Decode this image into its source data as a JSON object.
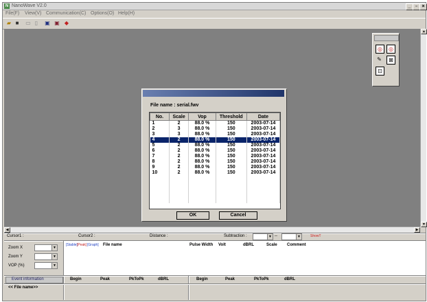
{
  "app": {
    "title": "NanoWave V2.0",
    "window_buttons": [
      "_",
      "▫",
      "×"
    ]
  },
  "menu": [
    "File(F)",
    "View(V)",
    "Communication(C)",
    "Options(O)",
    "Help(H)"
  ],
  "dialog": {
    "file_name": "File name : serial.fwv",
    "columns": [
      "No.",
      "Scale",
      "Vop",
      "Threshold",
      "Date"
    ],
    "rows": [
      [
        "1",
        "2",
        "88.0 %",
        "150",
        "2003-07-14"
      ],
      [
        "2",
        "3",
        "88.0 %",
        "150",
        "2003-07-14"
      ],
      [
        "3",
        "3",
        "88.0 %",
        "150",
        "2003-07-14"
      ],
      [
        "4",
        "2",
        "88.0 %",
        "150",
        "2003-07-14"
      ],
      [
        "5",
        "2",
        "88.0 %",
        "150",
        "2003-07-14"
      ],
      [
        "6",
        "2",
        "88.0 %",
        "150",
        "2003-07-14"
      ],
      [
        "7",
        "2",
        "88.0 %",
        "150",
        "2003-07-14"
      ],
      [
        "8",
        "2",
        "88.0 %",
        "150",
        "2003-07-14"
      ],
      [
        "9",
        "2",
        "88.0 %",
        "150",
        "2003-07-14"
      ],
      [
        "10",
        "2",
        "88.0 %",
        "150",
        "2003-07-14"
      ]
    ],
    "selected_row": 4,
    "ok_label": "OK",
    "cancel_label": "Cancel"
  },
  "status": {
    "cursor1": "Cursor1 :",
    "cursor2": "Cursor2 :",
    "distance": "Distance :",
    "subtraction": "Subtraction :",
    "dash": "--",
    "show_label": "ShowT"
  },
  "left_controls": {
    "zoom_x": "Zoom X",
    "zoom_y": "Zoom Y",
    "vop": "VOP (%)"
  },
  "list_header": {
    "tags": [
      "[Stable]",
      "[Peak]",
      "[Graph]"
    ],
    "file_name": "File name",
    "pulse_width": "Pulse Width",
    "volt": "Volt",
    "dbrl": "dBRL",
    "scale": "Scale",
    "comment": "Comment"
  },
  "event_header": {
    "event_info": "Event information",
    "file_name_row": "<< File name>>",
    "cols1": [
      "Begin",
      "Peak",
      "PkToPk",
      "dBRL"
    ],
    "cols2": [
      "Begin",
      "Peak",
      "PkToPk",
      "dBRL"
    ]
  },
  "colors": {
    "selected_row": "#0a246a",
    "tag_blue": "#2040c0",
    "tag_red": "#c02020",
    "show_red": "#d02020"
  }
}
